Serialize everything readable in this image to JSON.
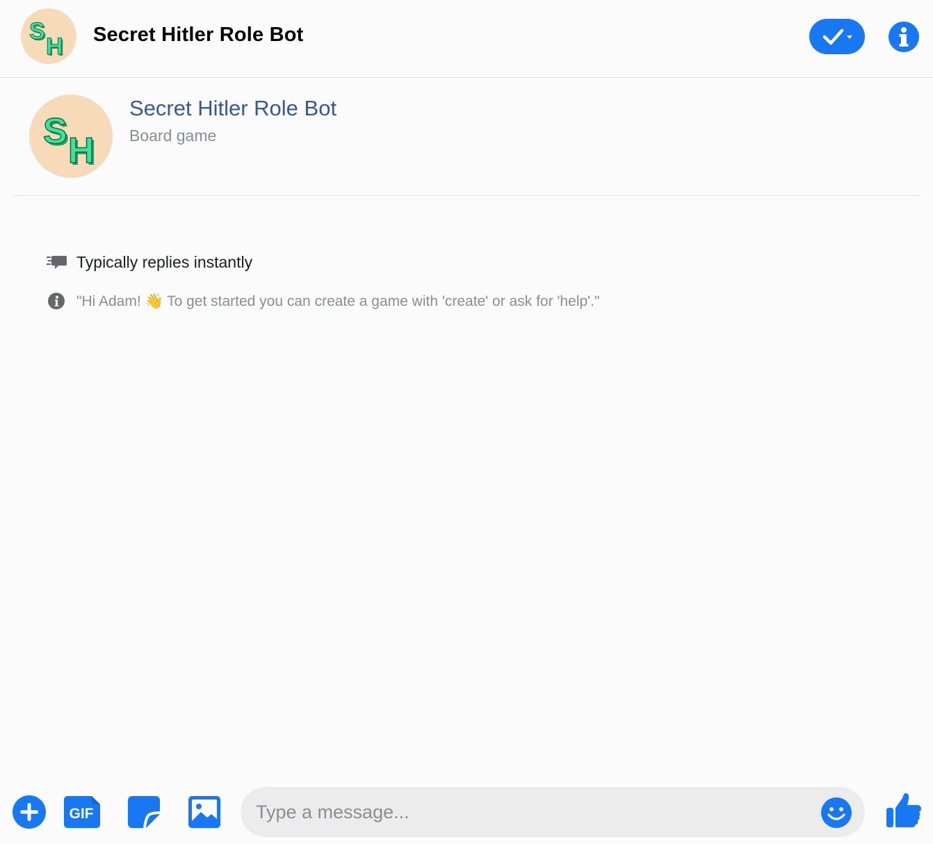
{
  "header": {
    "title": "Secret Hitler Role Bot",
    "avatar_letters": [
      "S",
      "H"
    ],
    "status_icon": "check-dropdown-icon",
    "info_icon": "info-icon"
  },
  "profile": {
    "name": "Secret Hitler Role Bot",
    "category": "Board game"
  },
  "details": {
    "replies": "Typically replies instantly",
    "greeting_prefix": "\"Hi Adam! ",
    "greeting_emoji": "👋",
    "greeting_suffix": " To get started you can create a game with 'create' or ask for 'help'.\""
  },
  "composer": {
    "placeholder": "Type a message...",
    "gif_label": "GIF",
    "tools": [
      "plus-icon",
      "gif-icon",
      "sticker-icon",
      "photo-icon"
    ],
    "emoji_icon": "smiley-icon",
    "like_icon": "thumbs-up-icon"
  },
  "colors": {
    "accent": "#1877f2",
    "name_link": "#365899",
    "avatar_bg": "#f7dbb9",
    "avatar_letters": "#2ecc8a"
  }
}
